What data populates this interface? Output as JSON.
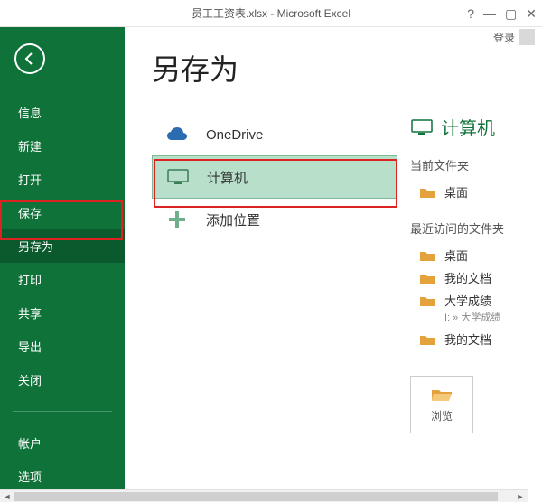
{
  "title": "员工工资表.xlsx - Microsoft Excel",
  "login": {
    "label": "登录"
  },
  "sidebar": {
    "items": [
      {
        "label": "信息"
      },
      {
        "label": "新建"
      },
      {
        "label": "打开"
      },
      {
        "label": "保存"
      },
      {
        "label": "另存为"
      },
      {
        "label": "打印"
      },
      {
        "label": "共享"
      },
      {
        "label": "导出"
      },
      {
        "label": "关闭"
      }
    ],
    "footer": [
      {
        "label": "帐户"
      },
      {
        "label": "选项"
      }
    ]
  },
  "page": {
    "heading": "另存为"
  },
  "locations": [
    {
      "label": "OneDrive"
    },
    {
      "label": "计算机"
    },
    {
      "label": "添加位置"
    }
  ],
  "right": {
    "header": "计算机",
    "current_section": "当前文件夹",
    "current_folder": {
      "label": "桌面"
    },
    "recent_section": "最近访问的文件夹",
    "recent": [
      {
        "label": "桌面"
      },
      {
        "label": "我的文档"
      },
      {
        "label": "大学成绩",
        "sub": "I: » 大学成绩"
      },
      {
        "label": "我的文档"
      }
    ],
    "browse": "浏览"
  }
}
